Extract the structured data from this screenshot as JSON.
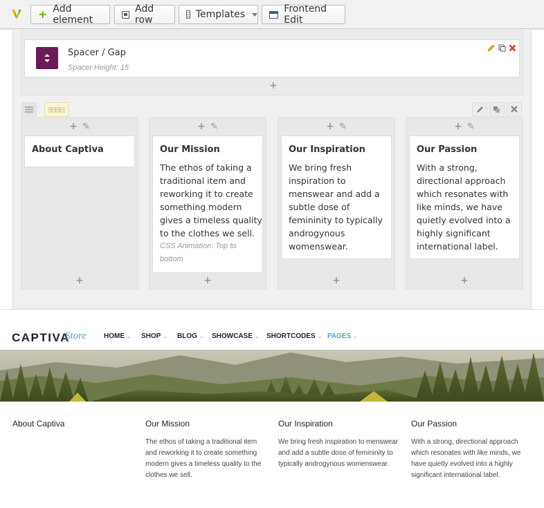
{
  "toolbar": {
    "add_element": "Add element",
    "add_row": "Add row",
    "templates": "Templates",
    "frontend_edit": "Frontend Edit"
  },
  "spacer": {
    "title": "Spacer / Gap",
    "subtitle": "Spacer Height: 15"
  },
  "columns": [
    {
      "title": "About Captiva",
      "body": "",
      "note": ""
    },
    {
      "title": "Our Mission",
      "body": "The ethos of taking a traditional item and reworking it to create something modern gives a timeless quality to the clothes we sell.",
      "note": "CSS Animation: Top to bottom"
    },
    {
      "title": "Our Inspiration",
      "body": "We bring fresh inspiration to menswear and add a subtle dose of femininity to typically androgynous womenswear.",
      "note": ""
    },
    {
      "title": "Our Passion",
      "body": "With a strong, directional approach which resonates with like minds, we have quietly evolved into a highly significant international label.",
      "note": ""
    }
  ],
  "site": {
    "logo_main": "CAPTIVA",
    "logo_store": "Store",
    "nav": [
      "HOME",
      "SHOP",
      "BLOG",
      "SHOWCASE",
      "SHORTCODES",
      "PAGES"
    ],
    "nav_active_color": "#4aa3d5",
    "sections": [
      {
        "title": "About Captiva",
        "body": ""
      },
      {
        "title": "Our Mission",
        "body": "The ethos of taking a traditional item and reworking it to create something modern gives a timeless quality to the clothes we sell."
      },
      {
        "title": "Our Inspiration",
        "body": "We bring fresh inspiration to menswear and add a subtle dose of femininity to typically androgynous womenswear."
      },
      {
        "title": "Our Passion",
        "body": "With a strong, directional approach which resonates with like minds, we have quietly evolved into a highly significant international label."
      }
    ]
  },
  "icons": {
    "vc_logo": "visual-composer-logo-icon",
    "add": "plus-icon",
    "edit": "pencil-icon",
    "clone": "copy-icon",
    "delete": "close-icon"
  },
  "colors": {
    "spacer_icon_bg": "#6d1a59",
    "add_green": "#6cb400",
    "delete_red": "#d9361c"
  }
}
